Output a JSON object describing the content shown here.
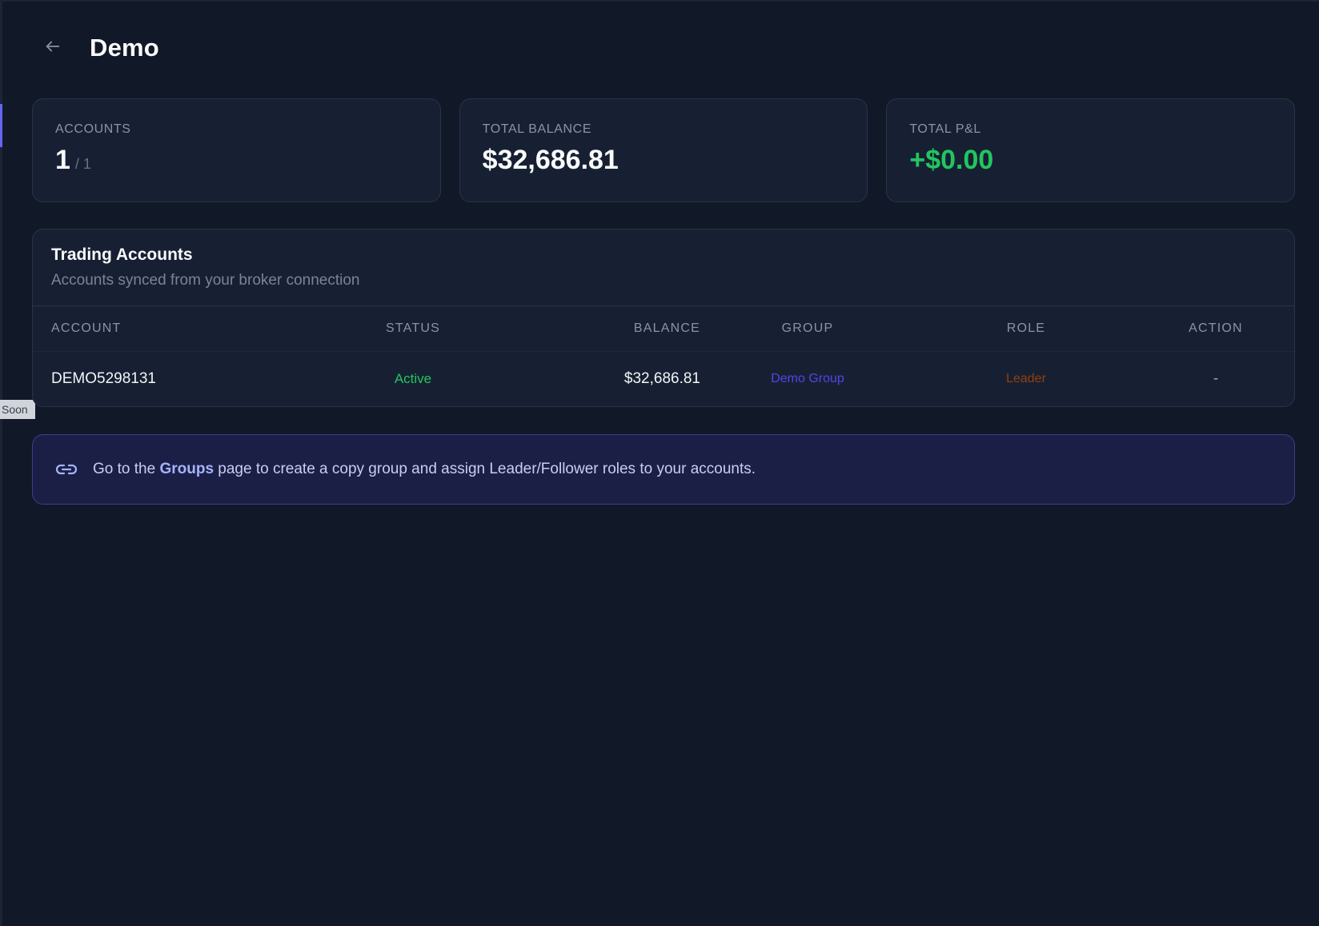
{
  "header": {
    "title": "Demo",
    "back_icon": "arrow-left-icon"
  },
  "sidebar_badge": {
    "label": "Soon"
  },
  "stats": [
    {
      "label": "ACCOUNTS",
      "value": "1",
      "sub": "/ 1"
    },
    {
      "label": "TOTAL BALANCE",
      "value": "$32,686.81"
    },
    {
      "label": "TOTAL P&L",
      "value": "+$0.00",
      "color": "#22c55e"
    }
  ],
  "trading_accounts": {
    "title": "Trading Accounts",
    "subtitle": "Accounts synced from your broker connection",
    "columns": [
      "ACCOUNT",
      "STATUS",
      "BALANCE",
      "GROUP",
      "ROLE",
      "ACTION"
    ],
    "rows": [
      {
        "account": "DEMO5298131",
        "status": "Active",
        "balance": "$32,686.81",
        "group": "Demo Group",
        "role": "Leader",
        "action": "-"
      }
    ]
  },
  "info": {
    "icon": "link-icon",
    "text_before": "Go to the ",
    "bold": "Groups",
    "text_after": " page to create a copy group and assign Leader/Follower roles to your accounts."
  },
  "colors": {
    "background": "#111827",
    "card": "#172033",
    "accent": "#6366f1",
    "positive": "#22c55e"
  }
}
